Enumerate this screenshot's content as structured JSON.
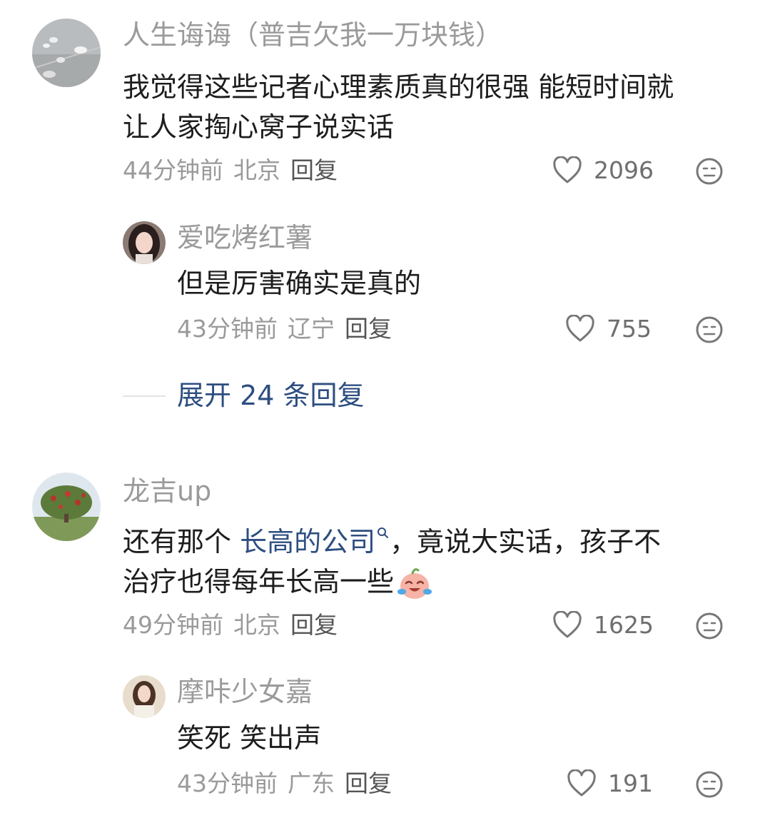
{
  "comments": [
    {
      "username": "人生诲诲（普吉欠我一万块钱）",
      "line1": "我觉得这些记者心理素质真的很强 能短时间就",
      "line2": "让人家掏心窝子说实话",
      "time": "44分钟前",
      "location": "北京",
      "reply": "回复",
      "likes": "2096"
    },
    {
      "username": "爱吃烤红薯",
      "line1": "但是厉害确实是真的",
      "time": "43分钟前",
      "location": "辽宁",
      "reply": "回复",
      "likes": "755"
    },
    {
      "username": "龙吉up",
      "line1_before": "还有那个 ",
      "line1_link": "长高的公司",
      "line1_after": "，竟说大实话，孩子不",
      "line2": "治疗也得每年长高一些",
      "time": "49分钟前",
      "location": "北京",
      "reply": "回复",
      "likes": "1625"
    },
    {
      "username": "摩咔少女嘉",
      "line1": "笑死 笑出声",
      "time": "43分钟前",
      "location": "广东",
      "reply": "回复",
      "likes": "191"
    }
  ],
  "expand_replies": "展开 24 条回复",
  "icons": {
    "like": "heart-outline-icon",
    "dislike": "neutral-face-icon",
    "search": "search-icon",
    "emoji": "crying-laughing-emoji"
  },
  "colors": {
    "link": "#2d4e80",
    "muted": "#9a9a9a",
    "text": "#1d1d1d"
  }
}
